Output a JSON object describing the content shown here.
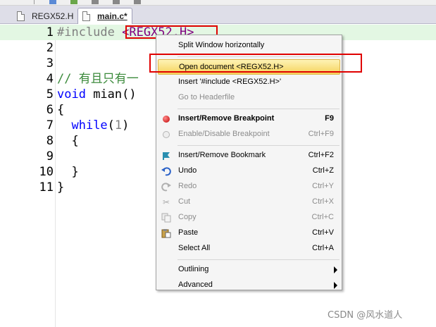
{
  "tabs": [
    {
      "label": "REGX52.H",
      "icon": "document-icon"
    },
    {
      "label": "main.c*",
      "icon": "document-icon",
      "active": true
    }
  ],
  "editor": {
    "lines": [
      {
        "no": "1",
        "parts": [
          {
            "t": "#include ",
            "c": "pre"
          },
          {
            "t": "<REGX52.H>",
            "c": "inc"
          }
        ]
      },
      {
        "no": "2",
        "parts": []
      },
      {
        "no": "3",
        "parts": []
      },
      {
        "no": "4",
        "parts": [
          {
            "t": "// 有且只有一",
            "c": "cmt"
          }
        ]
      },
      {
        "no": "5",
        "parts": [
          {
            "t": "void",
            "c": "kw"
          },
          {
            "t": " mian()",
            "c": "def"
          }
        ]
      },
      {
        "no": "6",
        "parts": [
          {
            "t": "{",
            "c": "def"
          }
        ]
      },
      {
        "no": "7",
        "parts": [
          {
            "t": "  ",
            "c": "def"
          },
          {
            "t": "while",
            "c": "kw"
          },
          {
            "t": "(",
            "c": "def"
          },
          {
            "t": "1",
            "c": "num"
          },
          {
            "t": ")",
            "c": "def"
          }
        ]
      },
      {
        "no": "8",
        "parts": [
          {
            "t": "  {",
            "c": "def"
          }
        ]
      },
      {
        "no": "9",
        "parts": []
      },
      {
        "no": "10",
        "parts": [
          {
            "t": "  }",
            "c": "def"
          }
        ]
      },
      {
        "no": "11",
        "parts": [
          {
            "t": "}",
            "c": "def"
          }
        ]
      }
    ]
  },
  "context_menu": {
    "items": [
      {
        "label": "Split Window horizontally",
        "shortcut": "",
        "icon": "",
        "state": "normal"
      },
      {
        "sep": true
      },
      {
        "label": "Open document <REGX52.H>",
        "shortcut": "",
        "icon": "",
        "state": "highlighted"
      },
      {
        "label": "Insert '#include <REGX52.H>'",
        "shortcut": "",
        "icon": "",
        "state": "normal"
      },
      {
        "label": "Go to Headerfile",
        "shortcut": "",
        "icon": "",
        "state": "disabled"
      },
      {
        "sep": true
      },
      {
        "label": "Insert/Remove Breakpoint",
        "shortcut": "F9",
        "icon": "breakpoint-icon",
        "state": "bold"
      },
      {
        "label": "Enable/Disable Breakpoint",
        "shortcut": "Ctrl+F9",
        "icon": "breakpoint-disabled-icon",
        "state": "disabled"
      },
      {
        "sep": true
      },
      {
        "label": "Insert/Remove Bookmark",
        "shortcut": "Ctrl+F2",
        "icon": "bookmark-icon",
        "state": "normal"
      },
      {
        "label": "Undo",
        "shortcut": "Ctrl+Z",
        "icon": "undo-icon",
        "state": "normal"
      },
      {
        "label": "Redo",
        "shortcut": "Ctrl+Y",
        "icon": "redo-icon",
        "state": "disabled"
      },
      {
        "label": "Cut",
        "shortcut": "Ctrl+X",
        "icon": "cut-icon",
        "state": "disabled"
      },
      {
        "label": "Copy",
        "shortcut": "Ctrl+C",
        "icon": "copy-icon",
        "state": "disabled"
      },
      {
        "label": "Paste",
        "shortcut": "Ctrl+V",
        "icon": "paste-icon",
        "state": "normal"
      },
      {
        "label": "Select All",
        "shortcut": "Ctrl+A",
        "icon": "",
        "state": "normal"
      },
      {
        "sep": true
      },
      {
        "label": "Outlining",
        "shortcut": "",
        "icon": "",
        "state": "normal",
        "submenu": true
      },
      {
        "label": "Advanced",
        "shortcut": "",
        "icon": "",
        "state": "normal",
        "submenu": true
      }
    ]
  },
  "watermark": "CSDN @风水道人",
  "colors": {
    "highlight_fill": "#f5d35a",
    "annotation_red": "#e00000",
    "active_line": "#e3f7e3",
    "keyword": "#0000ff",
    "include_path": "#800080",
    "comment": "#3b8a3b"
  }
}
